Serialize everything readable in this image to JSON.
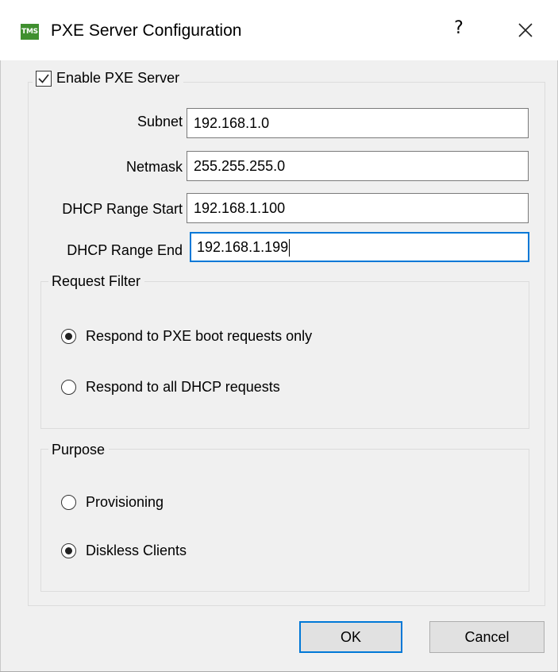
{
  "window": {
    "title": "PXE Server Configuration",
    "icon_text": "TMS",
    "help_label": "?"
  },
  "enable_pxe": {
    "label": "Enable PXE Server",
    "checked": true
  },
  "fields": {
    "subnet": {
      "label": "Subnet",
      "value": "192.168.1.0"
    },
    "netmask": {
      "label": "Netmask",
      "value": "255.255.255.0"
    },
    "range_start": {
      "label": "DHCP Range Start",
      "value": "192.168.1.100"
    },
    "range_end": {
      "label": "DHCP Range End",
      "value": "192.168.1.199"
    }
  },
  "request_filter": {
    "title": "Request Filter",
    "options": [
      {
        "label": "Respond to PXE boot requests only",
        "selected": true
      },
      {
        "label": "Respond to all DHCP requests",
        "selected": false
      }
    ]
  },
  "purpose": {
    "title": "Purpose",
    "options": [
      {
        "label": "Provisioning",
        "selected": false
      },
      {
        "label": "Diskless Clients",
        "selected": true
      }
    ]
  },
  "buttons": {
    "ok": "OK",
    "cancel": "Cancel"
  },
  "colors": {
    "focus": "#0078d7",
    "background": "#f0f0f0",
    "icon_green": "#3f8f2f"
  }
}
